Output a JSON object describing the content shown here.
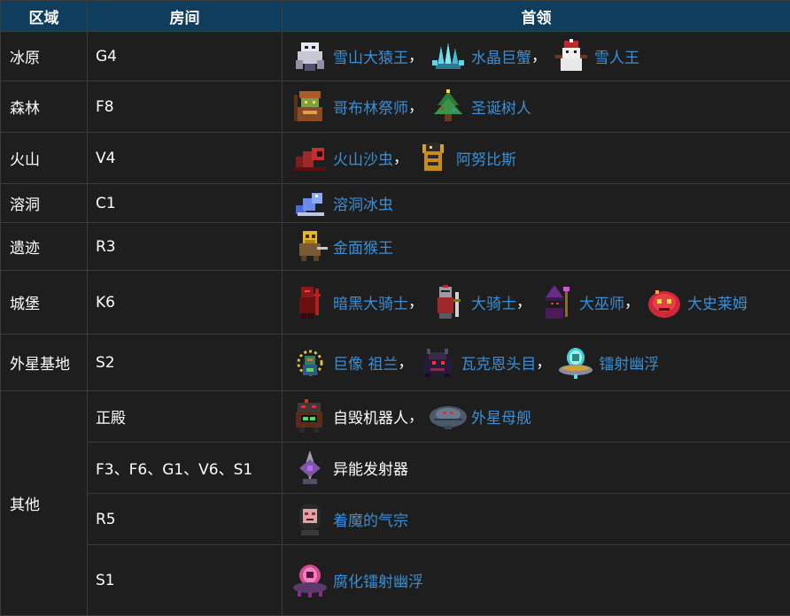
{
  "table": {
    "headers": {
      "region": "区域",
      "room": "房间",
      "boss": "首领"
    },
    "rows": [
      {
        "region": "冰原",
        "room": "G4",
        "bosses": [
          {
            "name": "雪山大猿王",
            "icon": "ape-king-icon",
            "link": true
          },
          {
            "name": "水晶巨蟹",
            "icon": "crystal-crab-icon",
            "link": true
          },
          {
            "name": "雪人王",
            "icon": "snowman-king-icon",
            "link": true
          }
        ]
      },
      {
        "region": "森林",
        "room": "F8",
        "bosses": [
          {
            "name": "哥布林祭师",
            "icon": "goblin-priest-icon",
            "link": true
          },
          {
            "name": "圣诞树人",
            "icon": "christmas-treant-icon",
            "link": true
          }
        ]
      },
      {
        "region": "火山",
        "room": "V4",
        "bosses": [
          {
            "name": "火山沙虫",
            "icon": "sandworm-icon",
            "link": true
          },
          {
            "name": "阿努比斯",
            "icon": "anubis-icon",
            "link": true
          }
        ]
      },
      {
        "region": "溶洞",
        "room": "C1",
        "bosses": [
          {
            "name": "溶洞冰虫",
            "icon": "ice-worm-icon",
            "link": true
          }
        ]
      },
      {
        "region": "遗迹",
        "room": "R3",
        "bosses": [
          {
            "name": "金面猴王",
            "icon": "golden-monkey-icon",
            "link": true
          }
        ]
      },
      {
        "region": "城堡",
        "room": "K6",
        "bosses": [
          {
            "name": "暗黑大骑士",
            "icon": "dark-knight-icon",
            "link": true
          },
          {
            "name": "大骑士",
            "icon": "grand-knight-icon",
            "link": true
          },
          {
            "name": "大巫师",
            "icon": "wizard-icon",
            "link": true
          },
          {
            "name": "大史莱姆",
            "icon": "slime-icon",
            "link": true
          }
        ]
      },
      {
        "region": "外星基地",
        "room": "S2",
        "bosses": [
          {
            "name": "巨像 祖兰",
            "icon": "colossus-icon",
            "link": true
          },
          {
            "name": "瓦克恩头目",
            "icon": "varkolyn-icon",
            "link": true
          },
          {
            "name": "镭射幽浮",
            "icon": "laser-ufo-icon",
            "link": true
          }
        ]
      }
    ],
    "other": {
      "region": "其他",
      "rows": [
        {
          "room": "正殿",
          "bosses": [
            {
              "name": "自毁机器人",
              "icon": "robot-icon",
              "link": false
            },
            {
              "name": "外星母舰",
              "icon": "mothership-icon",
              "link": true
            }
          ]
        },
        {
          "room": "F3、F6、G1、V6、S1",
          "bosses": [
            {
              "name": "异能发射器",
              "icon": "launcher-icon",
              "link": false
            }
          ]
        },
        {
          "room": "R5",
          "bosses": [
            {
              "name": "着魔的气宗",
              "icon": "possessed-master-icon",
              "link": true
            }
          ]
        },
        {
          "room": "S1",
          "bosses": [
            {
              "name": "腐化镭射幽浮",
              "icon": "corrupted-ufo-icon",
              "link": true
            }
          ]
        }
      ]
    }
  },
  "separator": "，",
  "colors": {
    "header_bg": "#0f3d5e",
    "cell_bg": "#1e1e1e",
    "border": "#3c3c3c",
    "link": "#3a8fd6",
    "text": "#ffffff"
  }
}
